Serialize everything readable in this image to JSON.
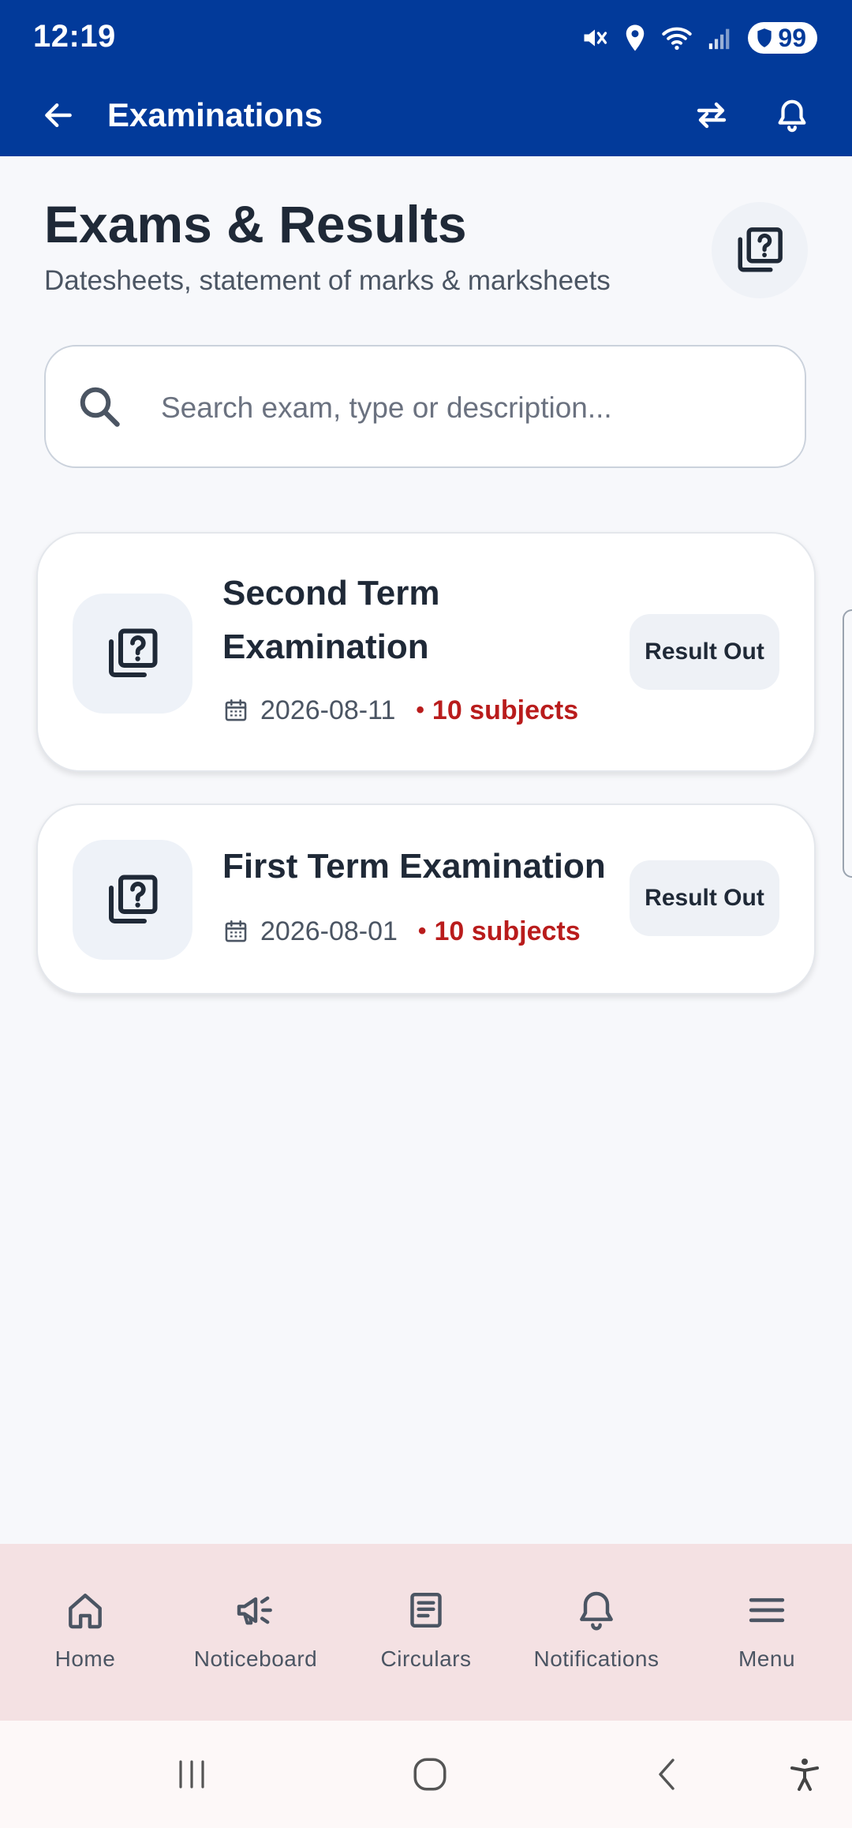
{
  "status_bar": {
    "time": "12:19",
    "battery": "99"
  },
  "app_bar": {
    "title": "Examinations"
  },
  "header": {
    "title": "Exams & Results",
    "subtitle": "Datesheets, statement of marks & marksheets"
  },
  "search": {
    "placeholder": "Search exam, type or description...",
    "value": ""
  },
  "exams": [
    {
      "title_line1": "Second Term",
      "title_line2": "Examination",
      "date": "2026-08-11",
      "subjects": "10 subjects",
      "status": "Result Out"
    },
    {
      "title": "First Term Examination",
      "date": "2026-08-01",
      "subjects": "10 subjects",
      "status": "Result Out"
    }
  ],
  "bottom_nav": [
    {
      "label": "Home",
      "icon": "home-icon"
    },
    {
      "label": "Noticeboard",
      "icon": "megaphone-icon"
    },
    {
      "label": "Circulars",
      "icon": "document-icon"
    },
    {
      "label": "Notifications",
      "icon": "bell-icon"
    },
    {
      "label": "Menu",
      "icon": "menu-icon"
    }
  ],
  "colors": {
    "primary": "#023A9A",
    "accent_red": "#B91C1C",
    "nav_bg": "#F4E1E3",
    "page_bg": "#F7F8FB"
  }
}
